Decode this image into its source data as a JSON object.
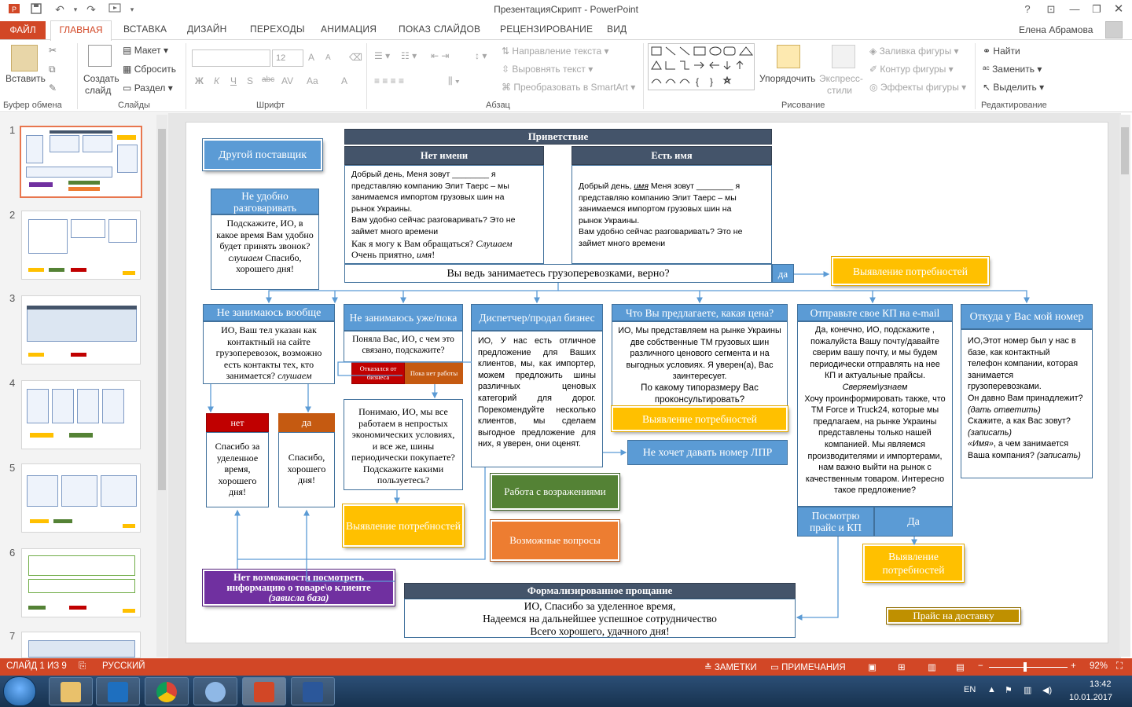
{
  "window": {
    "title": "ПрезентацияСкрипт - PowerPoint",
    "help": "?",
    "user": "Елена Абрамова"
  },
  "tabs": [
    "ФАЙЛ",
    "ГЛАВНАЯ",
    "ВСТАВКА",
    "ДИЗАЙН",
    "ПЕРЕХОДЫ",
    "АНИМАЦИЯ",
    "ПОКАЗ СЛАЙДОВ",
    "РЕЦЕНЗИРОВАНИЕ",
    "ВИД"
  ],
  "ribbon": {
    "clipboard": {
      "paste": "Вставить",
      "label": "Буфер обмена"
    },
    "slides": {
      "create_line1": "Создать",
      "create_line2": "слайд",
      "layout": "Макет",
      "reset": "Сбросить",
      "section": "Раздел",
      "label": "Слайды"
    },
    "font": {
      "size": "12",
      "label": "Шрифт",
      "bold": "Ж",
      "italic": "К",
      "underline": "Ч",
      "shadow": "S",
      "strike": "abc",
      "spacing": "AV",
      "case": "Aa",
      "color": "A",
      "grow": "A",
      "shrink": "A"
    },
    "paragraph": {
      "text_direction": "Направление текста",
      "align_text": "Выровнять текст",
      "smartart": "Преобразовать в SmartArt",
      "label": "Абзац"
    },
    "drawing": {
      "arrange": "Упорядочить",
      "quick_styles_1": "Экспресс-",
      "quick_styles_2": "стили",
      "fill": "Заливка фигуры",
      "outline": "Контур фигуры",
      "effects": "Эффекты фигуры",
      "label": "Рисование"
    },
    "editing": {
      "find": "Найти",
      "replace": "Заменить",
      "select": "Выделить",
      "label": "Редактирование"
    }
  },
  "thumbnails": [
    "1",
    "2",
    "3",
    "4",
    "5",
    "6",
    "7"
  ],
  "slide": {
    "greeting_header": "Приветствие",
    "no_name_header": "Нет имени",
    "has_name_header": "Есть имя",
    "no_name_text": [
      "Добрый день, Меня зовут ________ я",
      "представляю компанию Элит Таерс – мы",
      "занимаемся импортом грузовых шин на",
      "рынок Украины.",
      "Вам удобно сейчас разговаривать? Это не",
      "займет много времени"
    ],
    "no_name_ask": "Как я могу к Вам обращаться?",
    "no_name_ask_italic": "Слушаем",
    "no_name_nice": "Очень приятно,",
    "no_name_nice_italic": "имя",
    "has_name_text_1": "Добрый день,",
    "has_name_text_italic": "имя",
    "has_name_text_2": "Меня зовут ________ я",
    "has_name_text": [
      "представляю компанию Элит Таерс – мы",
      "занимаемся импортом грузовых шин на",
      "рынок Украины.",
      "Вам удобно сейчас разговаривать? Это не",
      "займет много времени"
    ],
    "question": "Вы ведь занимаетесь грузоперевозками, верно?",
    "yes": "да",
    "other_supplier": "Другой поставщик",
    "needs": "Выявление потребностей",
    "inconvenient_header": "Не удобно разговаривать",
    "inconvenient_text": "Подскажите, ИО, в какое время Вам удобно будет принять звонок?",
    "inconvenient_italic": "слушаем",
    "inconvenient_end": "Спасибо, хорошего дня!",
    "not_at_all_header": "Не занимаюсь вообще",
    "not_at_all_text": "ИО, Ваш тел указан как контактный на сайте грузоперевозок, возможно есть контакты тех, кто занимается?",
    "not_at_all_italic": "слушаем",
    "no_btn": "нет",
    "yes_btn": "да",
    "no_text": "Спасибо за уделенное время, хорошего дня!",
    "yes_text": "Спасибо, хорошего дня!",
    "not_anymore_header": "Не занимаюсь уже/пока",
    "not_anymore_text": "Поняла Вас, ИО, с чем это связано, подскажите?",
    "refused": "Отказался от бизнеса",
    "no_work": "Пока нет работы",
    "understand_text": "Понимаю, ИО, мы все работаем в непростых экономических условиях, и все же, шины периодически покупаете? Подскажите какими пользуетесь?",
    "dispatcher_header": "Диспетчер/продал бизнес",
    "dispatcher_text": "ИО, У нас есть отличное предложение для Ваших клиентов, мы, как импортер, можем предложить шины различных ценовых категорий для дорог. Порекомендуйте несколько клиентов, мы сделаем выгодное предложение для них, я уверен, они оценят.",
    "objections": "Работа с возражениями",
    "possible_questions": "Возможные вопросы",
    "what_offer_header": "Что Вы предлагаете, какая цена?",
    "what_offer_text": "ИО, Мы представляем на рынке Украины две собственные ТМ грузовых шин различного ценового сегмента и на выгодных условиях. Я уверен(а), Вас заинтересует.",
    "what_offer_q": "По какому типоразмеру Вас проконсультировать?",
    "no_lpr": "Не хочет давать номер ЛПР",
    "send_kp_header": "Отправьте свое КП на e-mail",
    "send_kp_text": "Да, конечно, ИО, подскажите , пожалуйста Вашу почту/давайте сверим вашу почту, и мы будем периодически отправлять на нее КП и актуальные прайсы.",
    "send_kp_italic": "Сверяем\\узнаем",
    "send_kp_text2": "Хочу проинформировать также, что TM Force и Truck24, которые мы предлагаем, на рынке Украины представлены только нашей компанией. Мы являемся производителями и импортерами, нам важно выйти на рынок с качественным товаром. Интересно такое предложение?",
    "will_look": "Посмотрю прайс и КП",
    "yes_cap": "Да",
    "where_number_header": "Откуда у Вас мой номер",
    "where_number_text1": "ИО,Этот номер был у нас в базе, как контактный телефон компании, которая занимается грузоперевозками.",
    "where_number_text2": "Он давно Вам принадлежит?",
    "where_number_italic2": "(дать ответить)",
    "where_number_text3": "Скажите, а как Вас зовут?",
    "where_number_italic3": "(записать)",
    "where_number_text4": "«Имя»",
    "where_number_text5": ", а чем занимается Ваша компания?",
    "where_number_italic5": "(записать)",
    "no_access_line1": "Нет возможности посмотреть",
    "no_access_line2": "информацию о товаре\\о клиенте",
    "no_access_line3": "(зависла база)",
    "farewell_header": "Формализированное прощание",
    "farewell_text": [
      "ИО, Спасибо за уделенное время,",
      "Надеемся на дальнейшее успешное сотрудничество",
      "Всего хорошего, удачного дня!"
    ],
    "delivery_price": "Прайс на доставку"
  },
  "status": {
    "slide": "СЛАЙД 1 ИЗ 9",
    "language": "РУССКИЙ",
    "notes": "ЗАМЕТКИ",
    "comments": "ПРИМЕЧАНИЯ",
    "zoom": "92%",
    "zoom_level": 0.92
  },
  "taskbar": {
    "lang": "EN",
    "time": "13:42",
    "date": "10.01.2017"
  },
  "colors": {
    "accent": "#d24726",
    "blue": "#5b9bd5",
    "dark": "#44546a",
    "yellow": "#ffc000",
    "green": "#548235",
    "orange": "#ed7d31",
    "purple": "#7030a0",
    "red": "#c00000"
  }
}
